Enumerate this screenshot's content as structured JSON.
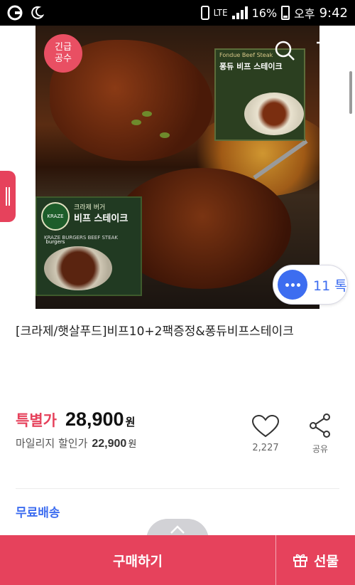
{
  "status_bar": {
    "network": "LTE",
    "battery": "16%",
    "ampm": "오후",
    "time": "9:42"
  },
  "hero": {
    "badge": "긴급\n공수",
    "box1_brand": "Fondue Beef Steak",
    "box1_title": "퐁듀 비프 스테이크",
    "box2_logo": "KRAZE burgers",
    "box2_sub": "크라제 버거",
    "box2_title": "비프 스테이크",
    "box2_eng": "KRAZE BURGERS BEEF STEAK",
    "chat_count": "11 톡"
  },
  "product": {
    "title": "[크라제/햇살푸드]비프10+2팩증정&퐁듀비프스테이크",
    "price_label": "특별가",
    "price": "28,900",
    "price_unit": "원",
    "mileage_label": "마일리지 할인가",
    "mileage_price": "22,900",
    "mileage_unit": "원",
    "like_count": "2,227",
    "share_label": "공유",
    "shipping": "무료배송"
  },
  "bottom_bar": {
    "buy": "구매하기",
    "gift": "선물"
  },
  "colors": {
    "accent": "#e6425c",
    "link_blue": "#3d6df0"
  }
}
